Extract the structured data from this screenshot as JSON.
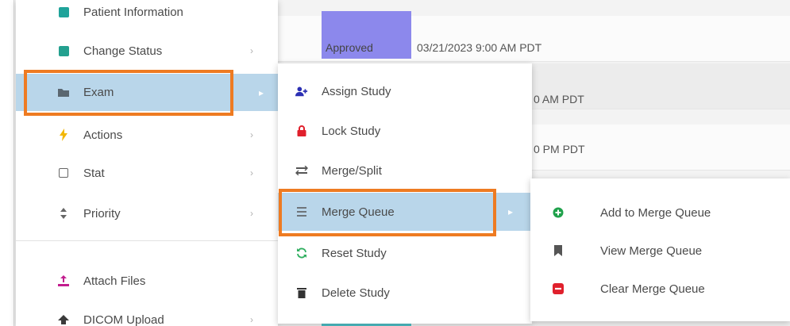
{
  "worklist": {
    "status": "Approved",
    "date": "03/21/2023 9:00 AM PDT",
    "row2_time": "0 AM PDT",
    "row3_time": "0 PM PDT"
  },
  "main_menu": {
    "items": [
      {
        "label": "Patient Information",
        "icon": "patient-icon",
        "color": "#1fa39a"
      },
      {
        "label": "Change Status",
        "icon": "square-icon",
        "color": "#23a08f"
      },
      {
        "label": "Exam",
        "icon": "folder-icon",
        "color": "#5b6770"
      },
      {
        "label": "Actions",
        "icon": "lightning-icon",
        "color": "#f2b705"
      },
      {
        "label": "Stat",
        "icon": "checkbox-icon",
        "color": "#666666"
      },
      {
        "label": "Priority",
        "icon": "sort-icon",
        "color": "#666666"
      },
      {
        "label": "Attach Files",
        "icon": "attach-icon",
        "color": "#c21d8e"
      },
      {
        "label": "DICOM Upload",
        "icon": "upload-icon",
        "color": "#3b3b3b"
      }
    ],
    "arrow": "›",
    "exam_arrow": "▸"
  },
  "exam_menu": {
    "items": [
      {
        "label": "Assign Study",
        "icon": "assign-user-icon",
        "color": "#2b2fb3"
      },
      {
        "label": "Lock Study",
        "icon": "lock-icon",
        "color": "#e0202c"
      },
      {
        "label": "Merge/Split",
        "icon": "merge-split-icon",
        "color": "#555555"
      },
      {
        "label": "Merge Queue",
        "icon": "list-icon",
        "color": "#555555"
      },
      {
        "label": "Reset Study",
        "icon": "reset-icon",
        "color": "#2fae5f"
      },
      {
        "label": "Delete Study",
        "icon": "trash-icon",
        "color": "#333333"
      }
    ],
    "queue_arrow": "▸"
  },
  "queue_menu": {
    "items": [
      {
        "label": "Add to Merge Queue",
        "icon": "add-circle-icon",
        "color": "#1fa14b"
      },
      {
        "label": "View Merge Queue",
        "icon": "bookmark-icon",
        "color": "#555555"
      },
      {
        "label": "Clear Merge Queue",
        "icon": "remove-icon",
        "color": "#e0202c"
      }
    ]
  },
  "highlight_color": "#ee7b22",
  "active_color": "#b9d6ea"
}
